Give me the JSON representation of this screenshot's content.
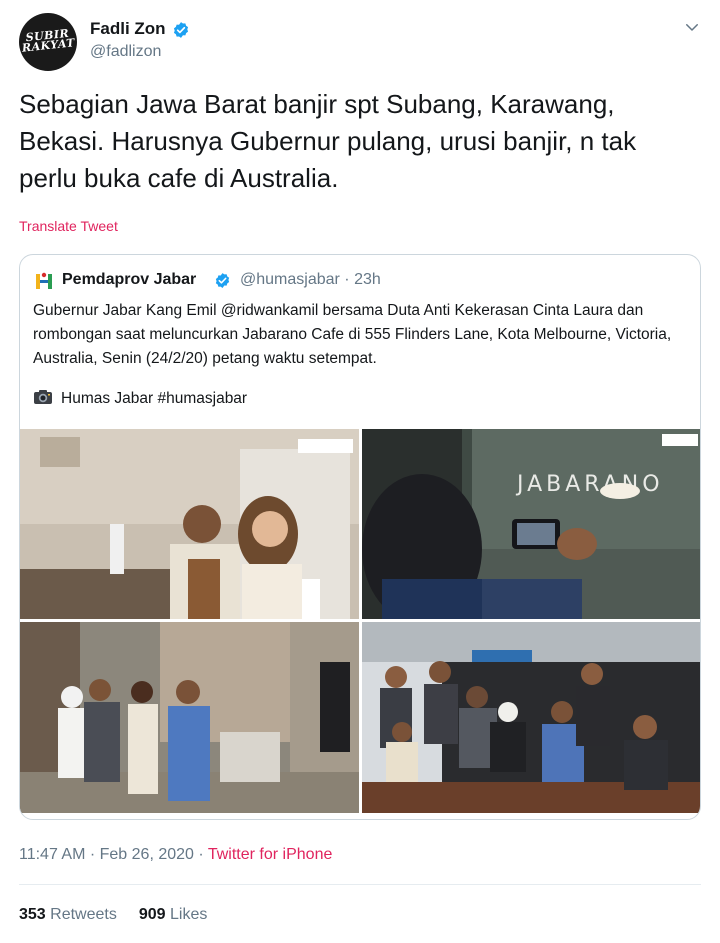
{
  "author": {
    "name": "Fadli Zon",
    "handle": "@fadlizon",
    "avatar_text_line1": "SUBIR",
    "avatar_text_line2": "RAKYAT"
  },
  "tweet": {
    "text": "Sebagian Jawa Barat banjir spt Subang, Karawang, Bekasi. Harusnya Gubernur pulang, urusi banjir,  n tak perlu buka cafe di Australia.",
    "translate_label": "Translate Tweet"
  },
  "quoted": {
    "name": "Pemdaprov Jabar",
    "handle_time": "@humasjabar · 23h",
    "text": "Gubernur Jabar Kang Emil @ridwankamil bersama Duta Anti Kekerasan Cinta Laura dan rombongan saat meluncurkan Jabarano Cafe di 555 Flinders Lane, Kota Melbourne, Victoria, Australia, Senin (24/2/20) petang waktu setempat.",
    "caption": "Humas Jabar #humasjabar",
    "cafe_sign": "JABARANO"
  },
  "meta": {
    "time_date": "11:47 AM · Feb 26, 2020 · ",
    "source": "Twitter for iPhone"
  },
  "stats": {
    "retweets_count": "353",
    "retweets_label": "Retweets",
    "likes_count": "909",
    "likes_label": "Likes"
  },
  "colors": {
    "verified": "#1da1f2",
    "link": "#e0245e",
    "muted": "#657786"
  }
}
